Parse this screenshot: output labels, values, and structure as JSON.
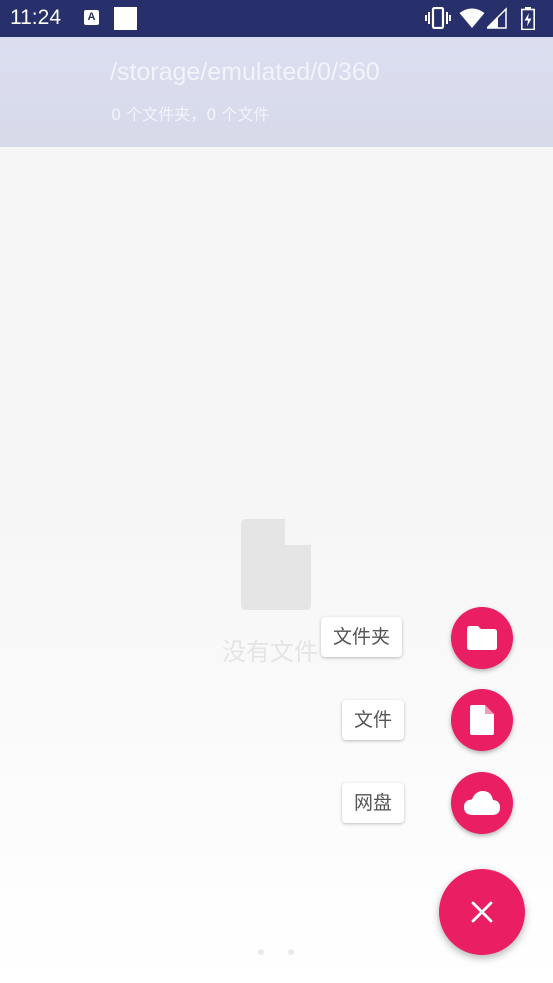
{
  "status_bar": {
    "time": "11:24",
    "notification_icon_letter": "A",
    "icons": [
      "text-notification-icon",
      "blank-notification-icon",
      "vibrate-icon",
      "wifi-icon",
      "signal-icon",
      "battery-icon"
    ]
  },
  "app_bar": {
    "path": "/storage/emulated/0/360",
    "summary": "0 个文件夹，0 个文件"
  },
  "empty_state": {
    "icon": "file-icon",
    "message": "没有文件"
  },
  "fab_menu": {
    "items": [
      {
        "label": "文件夹",
        "icon": "folder-icon"
      },
      {
        "label": "文件",
        "icon": "file-icon"
      },
      {
        "label": "网盘",
        "icon": "cloud-icon"
      }
    ],
    "main_icon": "close-icon"
  },
  "colors": {
    "status_bar": "#27306b",
    "accent": "#e91e63",
    "app_bar": "#c6cae3"
  }
}
